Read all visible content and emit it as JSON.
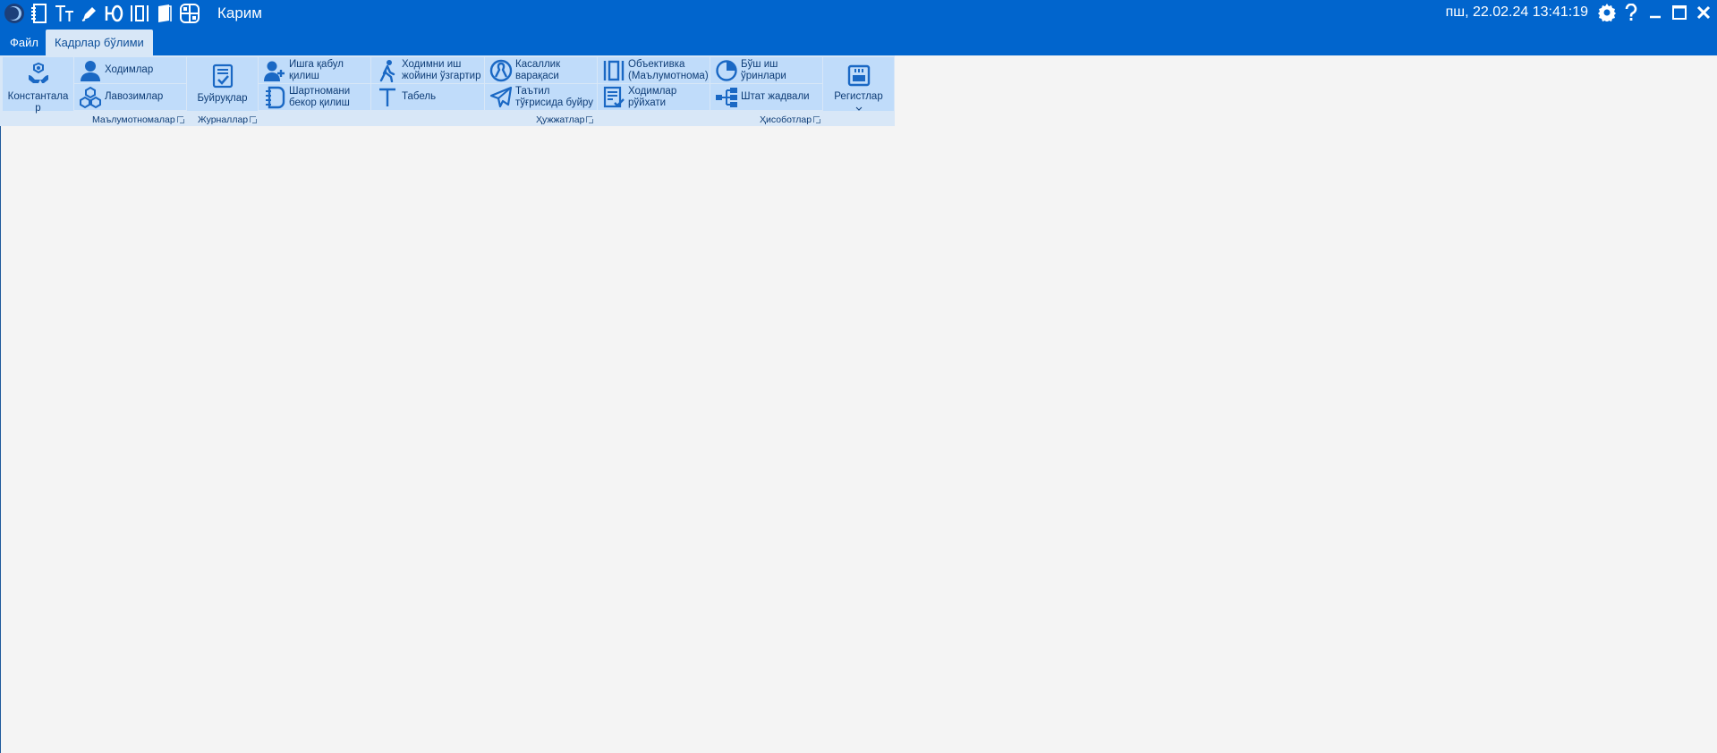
{
  "window": {
    "title": "Карим",
    "datetime": "пш, 22.02.24 13:41:19"
  },
  "quick_access": [
    {
      "icon": "app-logo-icon"
    },
    {
      "icon": "notebook-icon"
    },
    {
      "icon": "text-size-icon"
    },
    {
      "icon": "pen-icon"
    },
    {
      "icon": "yu-letters-icon"
    },
    {
      "icon": "columns-icon"
    },
    {
      "icon": "book-icon"
    },
    {
      "icon": "grid-icon"
    }
  ],
  "window_controls": [
    {
      "icon": "gear-icon"
    },
    {
      "icon": "help-icon"
    },
    {
      "icon": "minimize-icon"
    },
    {
      "icon": "maximize-icon"
    },
    {
      "icon": "close-icon"
    }
  ],
  "tabs": {
    "file": "Файл",
    "hr": "Кадрлар бўлими"
  },
  "ribbon": {
    "constants": {
      "label": "Константала р",
      "icon": "hands-cog-icon"
    },
    "employees": {
      "label": "Ходимлар",
      "icon": "person-icon"
    },
    "positions": {
      "label": "Лавозимлар",
      "icon": "hierarchy-icon"
    },
    "orders": {
      "label": "Буйруқлар",
      "icon": "document-check-icon"
    },
    "hire": {
      "label": "Ишга қабул қилиш",
      "icon": "person-add-icon"
    },
    "cancel_contract": {
      "label": "Шартномани бекор қилиш",
      "icon": "notebook-icon"
    },
    "change_workplace": {
      "label": "Ходимни иш жойини ўзгартир",
      "icon": "walking-person-icon"
    },
    "timesheet": {
      "label": "Табель",
      "icon": "letter-t-icon"
    },
    "sick_leave": {
      "label": "Касаллик варақаси",
      "icon": "ribbon-awareness-icon"
    },
    "vacation_order": {
      "label": "Таътил тўғрисида буйру",
      "icon": "paper-plane-icon"
    },
    "objective": {
      "label": "Объективка (Маълумотнома)",
      "icon": "columns-icon"
    },
    "employee_list": {
      "label": "Ходимлар рўйхати",
      "icon": "list-check-icon"
    },
    "vacancies": {
      "label": "Бўш иш ўринлари",
      "icon": "pie-chart-icon"
    },
    "staffing": {
      "label": "Штат жадвали",
      "icon": "org-tree-icon"
    },
    "registers": {
      "label": "Регистлар",
      "icon": "register-icon"
    }
  },
  "groups": {
    "references": "Маълумотномалар",
    "journals": "Журналлар",
    "documents": "Ҳужжатлар",
    "reports": "Ҳисоботлар"
  },
  "colors": {
    "titlebar": "#0165cd",
    "ribbon_bg": "#d8e7f7",
    "button_bg": "#c0dcfa",
    "icon": "#1a68c4",
    "workspace": "#f4f4f4"
  }
}
